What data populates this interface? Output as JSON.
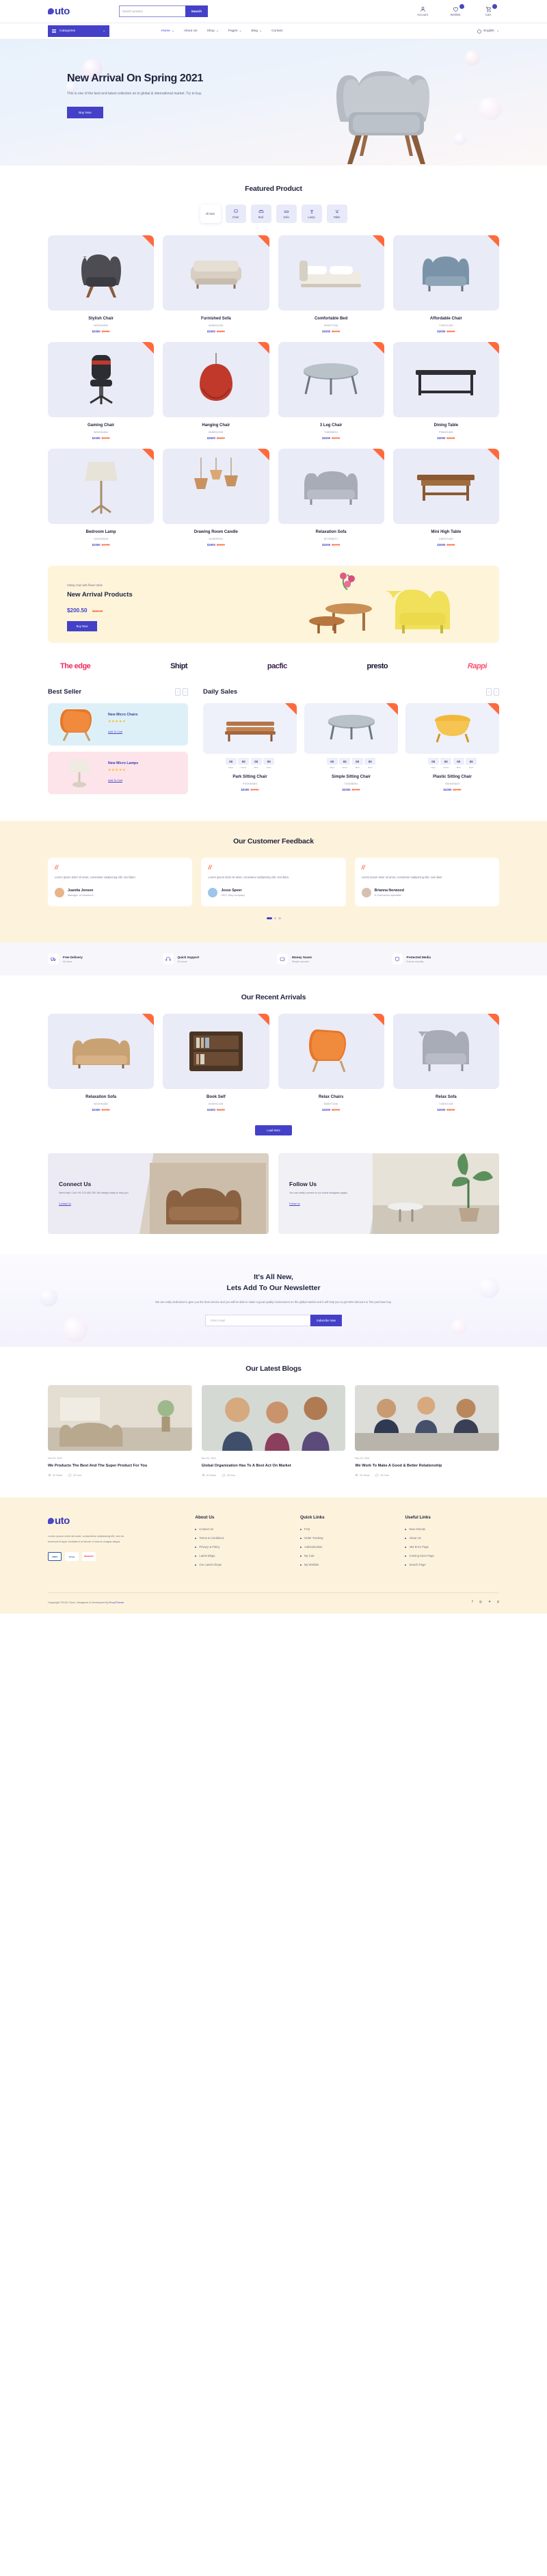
{
  "brand": {
    "name": "uto",
    "accent": "#4441c8",
    "orange": "#ff6a3d"
  },
  "header": {
    "search_placeholder": "Search product",
    "search_value": "",
    "search_button": "Search",
    "icons": [
      {
        "name": "account",
        "label": "Account",
        "badge": ""
      },
      {
        "name": "wishlist",
        "label": "Wishlist",
        "badge": "00"
      },
      {
        "name": "cart",
        "label": "Cart",
        "badge": "00"
      }
    ]
  },
  "nav": {
    "categories_label": "Categories",
    "items": [
      {
        "label": "Home",
        "caret": true,
        "active": true
      },
      {
        "label": "About Us",
        "caret": false,
        "active": false
      },
      {
        "label": "Shop",
        "caret": true,
        "active": false
      },
      {
        "label": "Pages",
        "caret": true,
        "active": false
      },
      {
        "label": "Blog",
        "caret": true,
        "active": false
      },
      {
        "label": "Contact",
        "caret": false,
        "active": false
      }
    ],
    "language": "English"
  },
  "hero": {
    "title": "New Arrival On Spring 2021",
    "desc": "This is one of the best and latest collection on to global & international market. Try to buy.",
    "cta": "Buy Now"
  },
  "featured": {
    "title": "Featured Product",
    "filters": [
      {
        "label": "All Item",
        "icon": "all-icon",
        "active": true
      },
      {
        "label": "Chair",
        "icon": "chair-icon",
        "active": false
      },
      {
        "label": "Bed",
        "icon": "bed-icon",
        "active": false
      },
      {
        "label": "Sofa",
        "icon": "sofa-icon",
        "active": false
      },
      {
        "label": "Lamp",
        "icon": "lamp-icon",
        "active": false
      },
      {
        "label": "Table",
        "icon": "table-icon",
        "active": false
      }
    ],
    "products": [
      {
        "name": "Stylish Chair",
        "code": "N03HN456",
        "now": "$2000",
        "was": "$1700",
        "img": "chair-grey"
      },
      {
        "name": "Furnished Sofa",
        "code": "M45HG435",
        "now": "$3000",
        "was": "$1500",
        "img": "sofa-beige"
      },
      {
        "name": "Comfortable Bed",
        "code": "B09HT456",
        "now": "$2000",
        "was": "$1700",
        "img": "bed-white"
      },
      {
        "name": "Affordable Chair",
        "code": "T45HG435",
        "now": "$3000",
        "was": "$1500",
        "img": "chair-blue"
      },
      {
        "name": "Gaming Chair",
        "code": "N03HN456",
        "now": "$2000",
        "was": "$1700",
        "img": "gaming-chair"
      },
      {
        "name": "Hanging Chair",
        "code": "M45HG435",
        "now": "$3000",
        "was": "$1500",
        "img": "hanging-chair"
      },
      {
        "name": "3 Leg Chair",
        "code": "T45DB891",
        "now": "$2000",
        "was": "$1700",
        "img": "three-leg-table"
      },
      {
        "name": "Dining Table",
        "code": "P98HG435",
        "now": "$3000",
        "was": "$1500",
        "img": "dining-table"
      },
      {
        "name": "Bedroom Lamp",
        "code": "G54HD845",
        "now": "$2000",
        "was": "$1700",
        "img": "floor-lamp"
      },
      {
        "name": "Drawing Room Candle",
        "code": "N45DR902",
        "now": "$3000",
        "was": "$1500",
        "img": "pendant-lamps"
      },
      {
        "name": "Relaxation Sofa",
        "code": "M73SB871",
        "now": "$2000",
        "was": "$1700",
        "img": "grey-sofa"
      },
      {
        "name": "Mini High Table",
        "code": "A80HG439",
        "now": "$3000",
        "was": "$1500",
        "img": "wood-table"
      }
    ]
  },
  "arrival": {
    "sub": "Sitting chair with flower table",
    "title": "New Arrival Products",
    "now": "$200.50",
    "was": "$300.00",
    "cta": "Buy Now"
  },
  "brands": [
    {
      "name": "The edge",
      "color": "#ef2a5f"
    },
    {
      "name": "Shipt",
      "color": "#1c1b3a"
    },
    {
      "name": "pacfic",
      "color": "#3c1e4f"
    },
    {
      "name": "presto",
      "color": "#141437"
    },
    {
      "name": "Rappi",
      "color": "#ff4d6d"
    }
  ],
  "best_seller": {
    "title": "Best Seller",
    "items": [
      {
        "name": "New Micro Chairs",
        "stars": "★★★★★",
        "cta": "Add To Cart",
        "bg": "#def0f7",
        "img": "orange-chair"
      },
      {
        "name": "New Micro Lamps",
        "stars": "★★★★★",
        "cta": "Add To Cart",
        "bg": "#fce4ea",
        "img": "white-lamp"
      }
    ]
  },
  "daily_sales": {
    "title": "Daily Sales",
    "timer_labels": [
      "Days",
      "Hours",
      "Mins",
      "Secs"
    ],
    "items": [
      {
        "name": "Park Sitting Chair",
        "code": "P03HN456",
        "now": "$2000",
        "was": "$1700",
        "timer": [
          "00",
          "00",
          "00",
          "00"
        ],
        "img": "bench"
      },
      {
        "name": "Simple Sitting Chair",
        "code": "T45DB891",
        "now": "$2000",
        "was": "$1700",
        "timer": [
          "00",
          "00",
          "00",
          "00"
        ],
        "img": "round-table"
      },
      {
        "name": "Plastic Sitting Chair",
        "code": "G54HD845",
        "now": "$2000",
        "was": "$1700",
        "timer": [
          "00",
          "00",
          "00",
          "00"
        ],
        "img": "yellow-stool"
      }
    ]
  },
  "feedback": {
    "title": "Our Customer Feedback",
    "items": [
      {
        "text": "Lorem ipsum dolor sit amet, consetetur sadipscing elitr, sed diam.",
        "name": "Juanita Jensen",
        "role": "Manager, eCommerce",
        "avatar": "#e8b48a"
      },
      {
        "text": "Lorem ipsum dolor sit amet, consetetur sadipscing elitr, sed diam.",
        "name": "Jesse Speer",
        "role": "CEO, Help company",
        "avatar": "#9fc5e8"
      },
      {
        "text": "Lorem ipsum dolor sit amet, consetetur sadipscing elitr, sed diam.",
        "name": "Brianna Norwood",
        "role": "E-Commerce specialist",
        "avatar": "#d8c0b0"
      }
    ],
    "dots": 3,
    "active_dot": 0
  },
  "features": [
    {
      "title": "Free Delivery",
      "sub": "At home",
      "icon": "truck-icon"
    },
    {
      "title": "Quick Support",
      "sub": "24 hours",
      "icon": "headset-icon"
    },
    {
      "title": "Money Saves",
      "sub": "Simple secured",
      "icon": "wallet-icon"
    },
    {
      "title": "Protected Media",
      "sub": "Ensure security",
      "icon": "shield-icon"
    }
  ],
  "recent": {
    "title": "Our Recent Arrivals",
    "products": [
      {
        "name": "Relaxation Sofa",
        "code": "N03HN456",
        "now": "$2000",
        "was": "$1700",
        "img": "tan-sofa"
      },
      {
        "name": "Book Self",
        "code": "M45HG435",
        "now": "$3000",
        "was": "$1500",
        "img": "bookshelf"
      },
      {
        "name": "Relax Chairs",
        "code": "B09HT456",
        "now": "$2000",
        "was": "$1700",
        "img": "orange-chair2"
      },
      {
        "name": "Relax Sofa",
        "code": "T45HG435",
        "now": "$3000",
        "was": "$1500",
        "img": "grey-armchair"
      }
    ],
    "load_more": "Load More"
  },
  "connect": {
    "title": "Connect Us",
    "desc": "Need help? Call +00 123 456 789. We always ready to help you.",
    "link": "Contact Us"
  },
  "follow": {
    "title": "Follow Us",
    "desc": "You can easily connect to our social Instagram pages.",
    "link": "Follow Us"
  },
  "newsletter": {
    "title_line1": "It's All New,",
    "title_line2": "Lets Add To Our Newsletter",
    "desc": "We are really dedicated to give you the best service and you will be able to make a good quality environment on the global market and it will help you to get 50% discount or first purchase buy.",
    "placeholder": "Enter email",
    "button": "Subscribe Now"
  },
  "blogs": {
    "title": "Our Latest Blogs",
    "items": [
      {
        "date": "Nov 02, 2021",
        "title": "We Products The Best And The Super Product For You",
        "views": "00 Views",
        "comments": "00 Com",
        "img": "living-room"
      },
      {
        "date": "Nov 02, 2021",
        "title": "Global Organization Has To A Best Act On Market",
        "views": "00 Views",
        "comments": "00 Com",
        "img": "people-market"
      },
      {
        "date": "Nov 02, 2021",
        "title": "We Work To Make A Good & Better Relationship",
        "views": "00 Views",
        "comments": "00 Com",
        "img": "meeting"
      }
    ]
  },
  "footer": {
    "about_text": "Lorem ipsum dolor sit amet, consectetur adipisicing elit, sed do eiusmod tempor incididunt ut labore et dolore magna aliqua.",
    "cards": [
      {
        "label": "AMEX",
        "bg": "#ffffff",
        "fg": "#2557a5"
      },
      {
        "label": "Cirrus",
        "bg": "#ffffff",
        "fg": "#1a4fa0"
      },
      {
        "label": "MasterCard",
        "bg": "#ffffff",
        "fg": "#eb001b"
      }
    ],
    "columns": [
      {
        "title": "About Us",
        "links": [
          "Contact Us",
          "Terms & Conditions",
          "Privacy & Policy",
          "Latest Blogs",
          "Our Latest Shops"
        ]
      },
      {
        "title": "Quick Links",
        "links": [
          "FAQ",
          "Order Tracking",
          "Authentication",
          "My Cart",
          "My Wishlist"
        ]
      },
      {
        "title": "Useful Links",
        "links": [
          "New Arrivals",
          "About Us",
          "404 Error Page",
          "Coming Soon Page",
          "Search Page"
        ]
      }
    ],
    "copyright_pre": "Copyright ©2021 Outo. Designed & Developed By ",
    "copyright_brand": "EnvyTheme",
    "socials": [
      "facebook-icon",
      "instagram-icon",
      "twitter-icon",
      "pinterest-icon"
    ]
  }
}
